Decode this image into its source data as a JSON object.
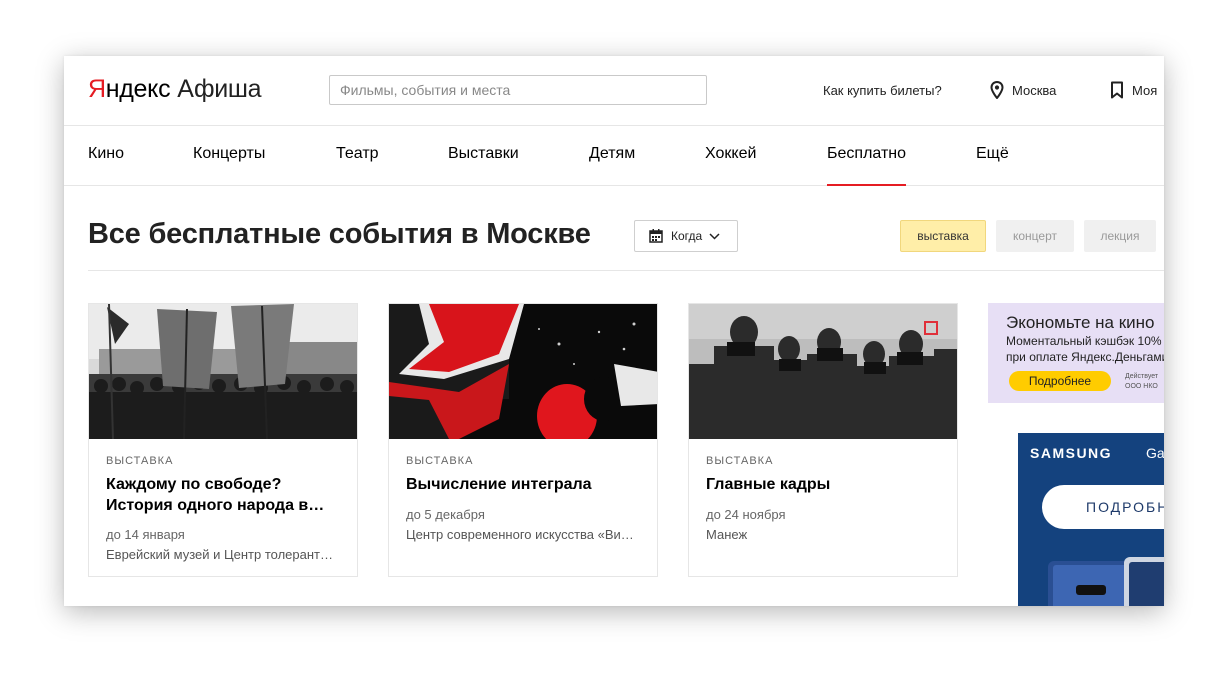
{
  "header": {
    "logo_yandex_first": "Я",
    "logo_yandex_rest": "ндекс",
    "logo_afisha": "Афиша",
    "search_placeholder": "Фильмы, события и места",
    "how_to_buy": "Как купить билеты?",
    "city": "Москва",
    "my_label": "Моя"
  },
  "nav": {
    "items": [
      {
        "label": "Кино"
      },
      {
        "label": "Концерты"
      },
      {
        "label": "Театр"
      },
      {
        "label": "Выставки"
      },
      {
        "label": "Детям"
      },
      {
        "label": "Хоккей"
      },
      {
        "label": "Бесплатно",
        "active": true
      },
      {
        "label": "Ещё"
      }
    ]
  },
  "main": {
    "title": "Все бесплатные события в Москве",
    "when_label": "Когда",
    "filters": [
      "выставка",
      "концерт",
      "лекция"
    ],
    "active_filter": "выставка"
  },
  "cards": [
    {
      "category": "ВЫСТАВКА",
      "title": "Каждому по свободе? История одного народа в…",
      "date": "до 14 января",
      "place": "Еврейский музей и Центр толерант…"
    },
    {
      "category": "ВЫСТАВКА",
      "title": "Вычисление интеграла",
      "date": "до 5 декабря",
      "place": "Центр современного искусства «Ви…"
    },
    {
      "category": "ВЫСТАВКА",
      "title": "Главные кадры",
      "date": "до 24 ноября",
      "place": "Манеж"
    }
  ],
  "ads": {
    "ad1": {
      "headline": "Экономьте на кино",
      "line1": "Моментальный кэшбэк 10%",
      "line2": "при оплате Яндекс.Деньгами",
      "button": "Подробнее",
      "small1": "Действует",
      "small2": "ООО НКО"
    },
    "ad2": {
      "brand": "SAMSUNG",
      "brand_suffix": "Ga",
      "button": "ПОДРОБНЕЕ"
    }
  },
  "colors": {
    "accent_red": "#e51c23",
    "active_filter_bg": "#ffeea8",
    "inactive_filter_bg": "#f0f0f0",
    "ad1_bg": "#e7dff5",
    "ad1_button": "#ffcc00",
    "ad2_bg": "#14427e"
  }
}
